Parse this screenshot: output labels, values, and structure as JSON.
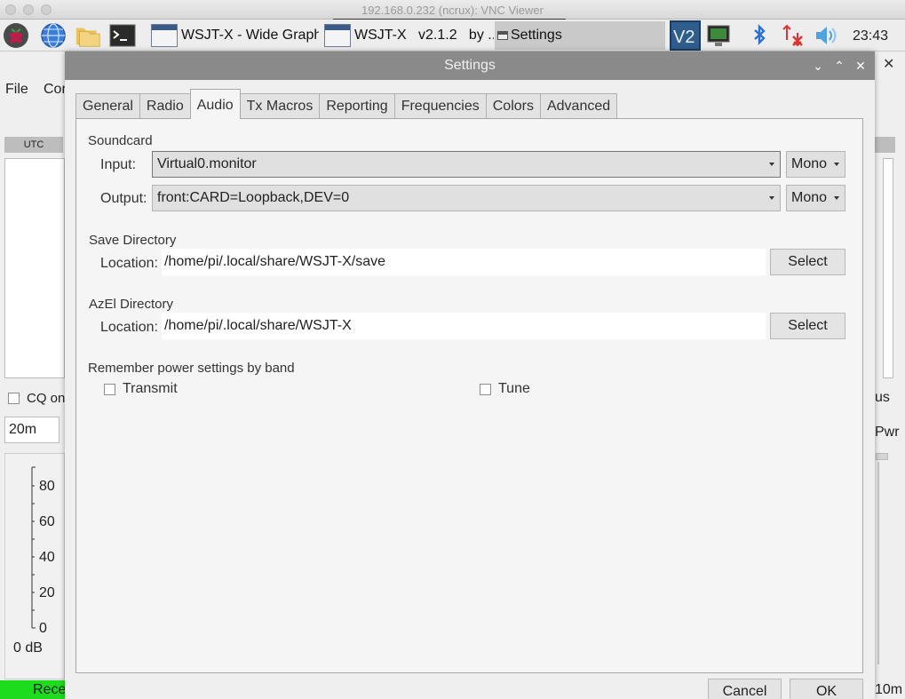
{
  "vnc_title": "192.168.0.232 (ncrux): VNC Viewer",
  "taskbar": {
    "tasks": [
      {
        "label": "WSJT-X - Wide Graph"
      },
      {
        "label": "WSJT-X   v2.1.2   by ..."
      },
      {
        "label": "Settings"
      }
    ],
    "clock": "23:43"
  },
  "background_window": {
    "menu": [
      "File",
      "Cor"
    ],
    "utc_header": "UTC",
    "cq_label": "CQ on",
    "band": "20m",
    "meter_ticks": [
      "80",
      "60",
      "40",
      "20",
      "0"
    ],
    "meter_unit": "0 dB",
    "status": "Rece",
    "right_labels": [
      "us",
      "Pwr",
      "10m"
    ]
  },
  "dialog": {
    "title": "Settings",
    "tabs": [
      "General",
      "Radio",
      "Audio",
      "Tx Macros",
      "Reporting",
      "Frequencies",
      "Colors",
      "Advanced"
    ],
    "active_tab": "Audio",
    "soundcard": {
      "title": "Soundcard",
      "input_label": "Input:",
      "input_value": "Virtual0.monitor",
      "input_channel": "Mono",
      "output_label": "Output:",
      "output_value": "front:CARD=Loopback,DEV=0",
      "output_channel": "Mono"
    },
    "save_dir": {
      "title": "Save Directory",
      "location_label": "Location:",
      "value": "/home/pi/.local/share/WSJT-X/save",
      "select": "Select"
    },
    "azel_dir": {
      "title": "AzEl Directory",
      "location_label": "Location:",
      "value": "/home/pi/.local/share/WSJT-X",
      "select": "Select"
    },
    "power": {
      "title": "Remember power settings by band",
      "transmit": "Transmit",
      "tune": "Tune"
    },
    "cancel": "Cancel",
    "ok": "OK"
  }
}
